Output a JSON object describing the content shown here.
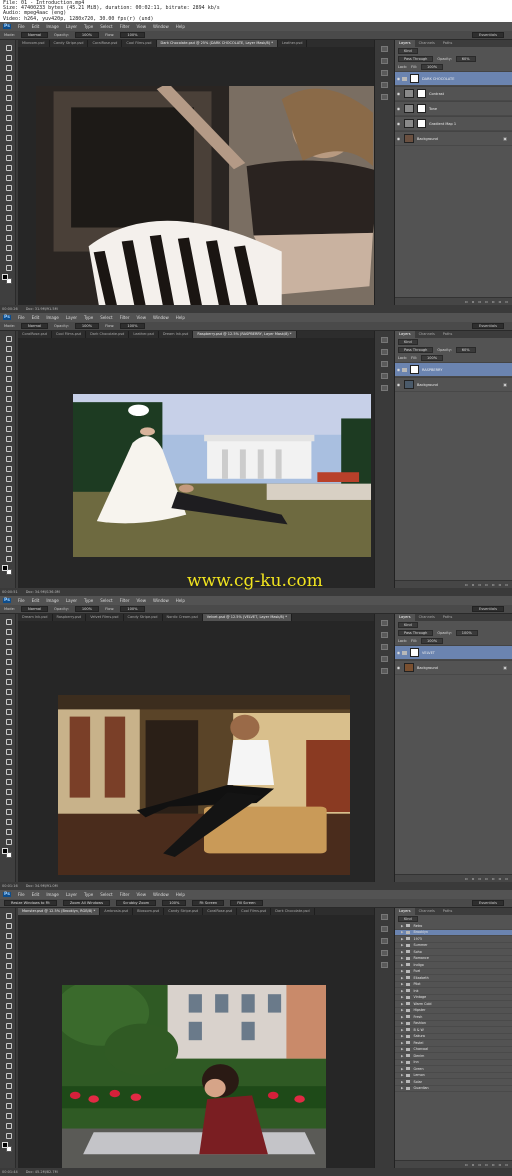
{
  "video_meta": {
    "line1": "File: 01 - Introduction.mp4",
    "line2": "Size: 47400233 bytes (45.21 MiB), duration: 00:02:11, bitrate: 2894 kb/s",
    "line3": "Audio: mpeg4aac (eng)",
    "line4": "Video: h264, yuv420p, 1280x720, 30.00 fps(r) (und)"
  },
  "menu": [
    "File",
    "Edit",
    "Image",
    "Layer",
    "Type",
    "Select",
    "Filter",
    "View",
    "Window",
    "Help"
  ],
  "ps_logo": "Ps",
  "options": {
    "mode_label": "Mode:",
    "mode_value": "Normal",
    "opacity_label": "Opacity:",
    "opacity_value": "100%",
    "flow_label": "Flow:",
    "flow_value": "100%",
    "workspace": "Essentials"
  },
  "panel": {
    "tabs": [
      "Layers",
      "Channels",
      "Paths"
    ],
    "kind": "Kind",
    "blend": "Pass Through",
    "opacity_label": "Opacity:",
    "opacity_value": "100%",
    "lock_label": "Lock:",
    "fill_label": "Fill:",
    "fill_value": "100%"
  },
  "frames": [
    {
      "tabs": [
        "Mixroom.psd",
        "Candy Stripe.psd",
        "CoralRose.psd",
        "Cool Films.psd",
        "Dark Chocolate.psd @ 25% (DARK CHOCOLATE, Layer Mask/8) *",
        "Leather.psd"
      ],
      "active_tab": 4,
      "opacity_value": "60%",
      "layers": [
        {
          "name": "DARK CHOCOLATE",
          "type": "group",
          "selected": true
        },
        {
          "name": "Contrast",
          "type": "adjustment",
          "selected": false
        },
        {
          "name": "Tone",
          "type": "adjustment",
          "selected": false
        },
        {
          "name": "Gradient Map 1",
          "type": "adjustment",
          "selected": false
        },
        {
          "name": "Background",
          "type": "image",
          "selected": false
        }
      ],
      "status": "00:00:26",
      "doc": "Doc: 31.9M/91.5M"
    },
    {
      "tabs": [
        "CoralRose.psd",
        "Cool Films.psd",
        "Dark Chocolate.psd",
        "Leather.psd",
        "Dream Ink.psd",
        "Raspberry.psd @ 12.5% (RASPBERRY, Layer Mask/8) *"
      ],
      "active_tab": 5,
      "opacity_value": "60%",
      "layers": [
        {
          "name": "RASPBERRY",
          "type": "group",
          "selected": true
        },
        {
          "name": "Background",
          "type": "image",
          "selected": false
        }
      ],
      "status": "00:00:51",
      "doc": "Doc: 34.9M/136.0M"
    },
    {
      "tabs": [
        "Dream Ink.psd",
        "Raspberry.psd",
        "Velvet Films.psd",
        "Candy Stripe.psd",
        "Nordic Cream.psd",
        "Velvet.psd @ 12.5% (VELVET, Layer Mask/8) *"
      ],
      "active_tab": 5,
      "opacity_value": "100%",
      "layers": [
        {
          "name": "VELVET",
          "type": "group",
          "selected": true
        },
        {
          "name": "Background",
          "type": "image",
          "selected": false
        }
      ],
      "status": "00:01:16",
      "doc": "Doc: 34.9M/91.0M"
    },
    {
      "tabs": [
        "Monster.psd @ 12.5% (Brooklyn, RGB/8) *",
        "Ambrosia.psd",
        "Blossom.psd",
        "Candy Stripe.psd",
        "CoralRose.psd",
        "Cool Films.psd",
        "Dark Chocolate.psd"
      ],
      "active_tab": 0,
      "options_bar": [
        "Resize Windows to Fit",
        "Zoom All Windows",
        "Scrubby Zoom",
        "100%",
        "Fit Screen",
        "Fill Screen"
      ],
      "presets": [
        "Retro",
        "Brooklyn",
        "1975",
        "Summer",
        "Soho",
        "Romance",
        "Indigo",
        "Fuel",
        "Elizabeth",
        "Pilot",
        "Ink",
        "Vintage",
        "Warm Cold",
        "Hipster",
        "Fresh",
        "Fashion",
        "B & W",
        "Sakura",
        "Pastel",
        "Charcoal",
        "Denim",
        "Inn",
        "Green",
        "Lemon",
        "Solar",
        "Guardian"
      ],
      "selected_preset": 1,
      "status": "00:01:44",
      "doc": "Doc: 45.2M/82.7M"
    }
  ],
  "watermark": "www.cg-ku.com"
}
